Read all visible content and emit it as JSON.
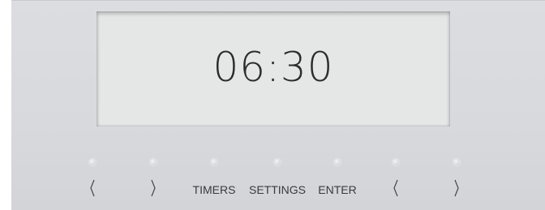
{
  "display": {
    "time": "06:30"
  },
  "controls": [
    {
      "name": "left-arrow-1",
      "kind": "arrow",
      "icon": "chevron-left-icon"
    },
    {
      "name": "right-arrow-1",
      "kind": "arrow",
      "icon": "chevron-right-icon"
    },
    {
      "name": "timers",
      "kind": "text",
      "label": "TIMERS"
    },
    {
      "name": "settings",
      "kind": "text",
      "label": "SETTINGS"
    },
    {
      "name": "enter",
      "kind": "text",
      "label": "ENTER"
    },
    {
      "name": "left-arrow-2",
      "kind": "arrow",
      "icon": "chevron-left-icon"
    },
    {
      "name": "right-arrow-2",
      "kind": "arrow",
      "icon": "chevron-right-icon"
    }
  ],
  "colors": {
    "panel": "#d9dade",
    "screen": "#e5e6e6",
    "text": "#2c2c2e",
    "led": "#e6e7ea"
  }
}
